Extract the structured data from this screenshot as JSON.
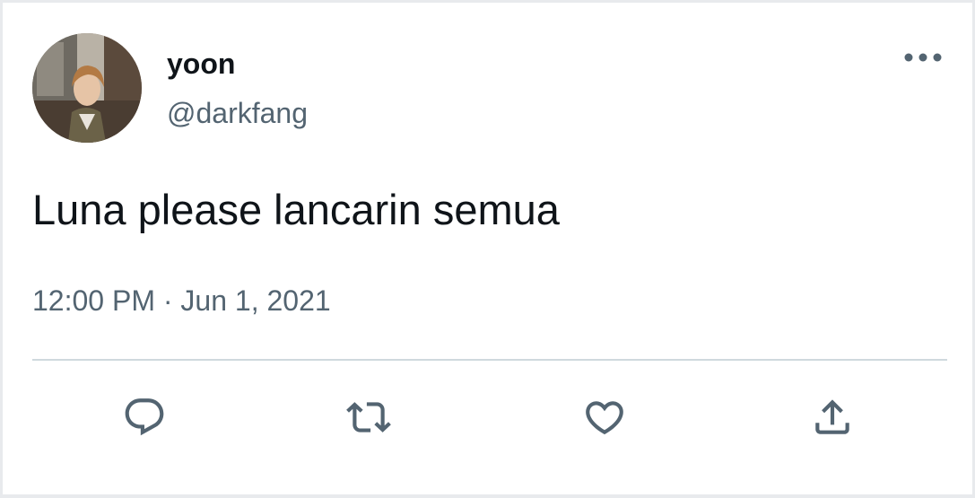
{
  "tweet": {
    "author": {
      "display_name": "yoon",
      "handle": "@darkfang"
    },
    "text": "Luna please lancarin semua",
    "time": "12:00 PM",
    "separator": "·",
    "date": "Jun 1, 2021"
  },
  "icons": {
    "more": "more-horizontal-icon",
    "reply": "reply-icon",
    "retweet": "retweet-icon",
    "like": "heart-icon",
    "share": "share-icon"
  },
  "colors": {
    "text_primary": "#0f1419",
    "text_secondary": "#536471",
    "divider": "#cfd9de"
  }
}
